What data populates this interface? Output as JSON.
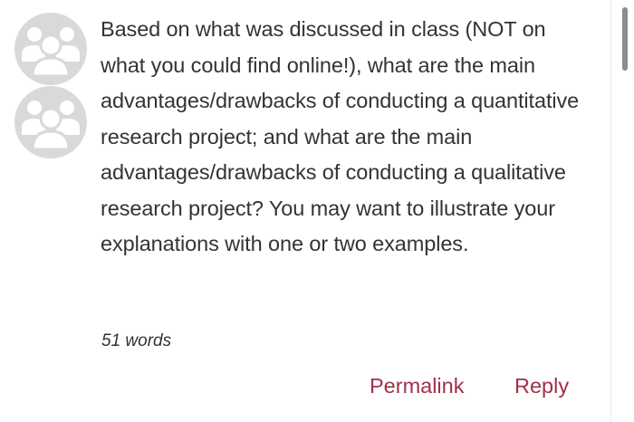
{
  "post": {
    "body": "Based on what was discussed in class (NOT on what you could find online!), what are the main advantages/drawbacks of conducting a quantitative research project; and what are the main advantages/drawbacks of conducting a qualitative research project? You may want to illustrate your explanations with one or two examples.",
    "word_count": "51 words"
  },
  "actions": {
    "permalink_label": "Permalink",
    "reply_label": "Reply"
  },
  "avatars": [
    {
      "icon": "group-avatar-icon"
    },
    {
      "icon": "group-avatar-icon"
    }
  ],
  "colors": {
    "link": "#a2304a",
    "text": "#333333",
    "avatar_bg": "#d9d9d9"
  }
}
